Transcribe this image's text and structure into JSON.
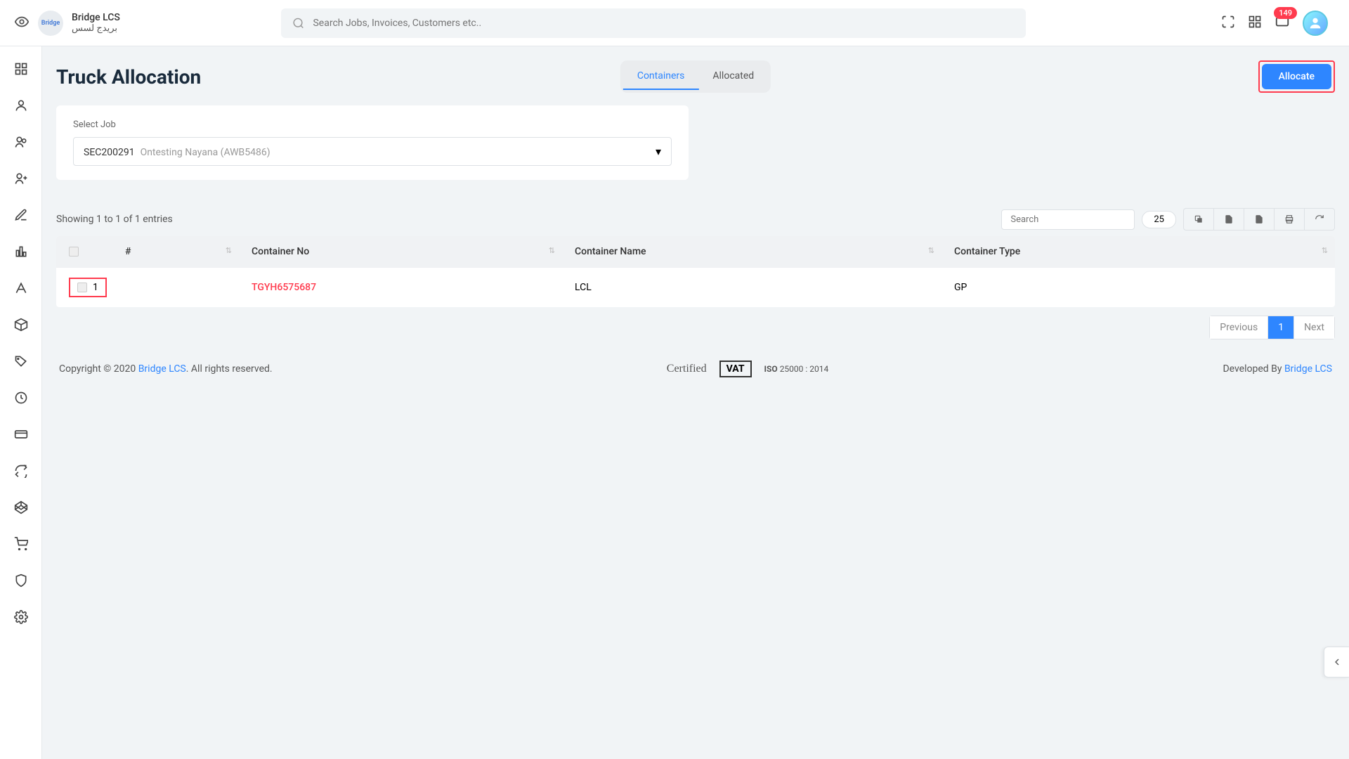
{
  "app": {
    "name": "Bridge LCS",
    "name_arabic": "بريدج لسس",
    "logo_text": "Bridge"
  },
  "header": {
    "search_placeholder": "Search Jobs, Invoices, Customers etc..",
    "notification_count": "149"
  },
  "page": {
    "title": "Truck Allocation"
  },
  "tabs": {
    "containers": "Containers",
    "allocated": "Allocated"
  },
  "actions": {
    "allocate": "Allocate"
  },
  "job_select": {
    "label": "Select Job",
    "code": "SEC200291",
    "desc": "Ontesting Nayana (AWB5486)"
  },
  "table_meta": {
    "entries_text": "Showing 1 to 1 of 1 entries",
    "search_placeholder": "Search",
    "page_size": "25"
  },
  "columns": {
    "hash": "#",
    "container_no": "Container No",
    "container_name": "Container Name",
    "container_type": "Container Type"
  },
  "rows": [
    {
      "num": "1",
      "container_no": "TGYH6575687",
      "container_name": "LCL",
      "container_type": "GP"
    }
  ],
  "pagination": {
    "previous": "Previous",
    "page1": "1",
    "next": "Next"
  },
  "footer": {
    "copyright_prefix": "Copyright © 2020 ",
    "link": "Bridge LCS",
    "copyright_suffix": ". All rights reserved.",
    "certified": "Certified",
    "vat": "VAT",
    "iso": "25000 : 2014",
    "developed_prefix": "Developed By ",
    "developed_link": "Bridge LCS"
  }
}
